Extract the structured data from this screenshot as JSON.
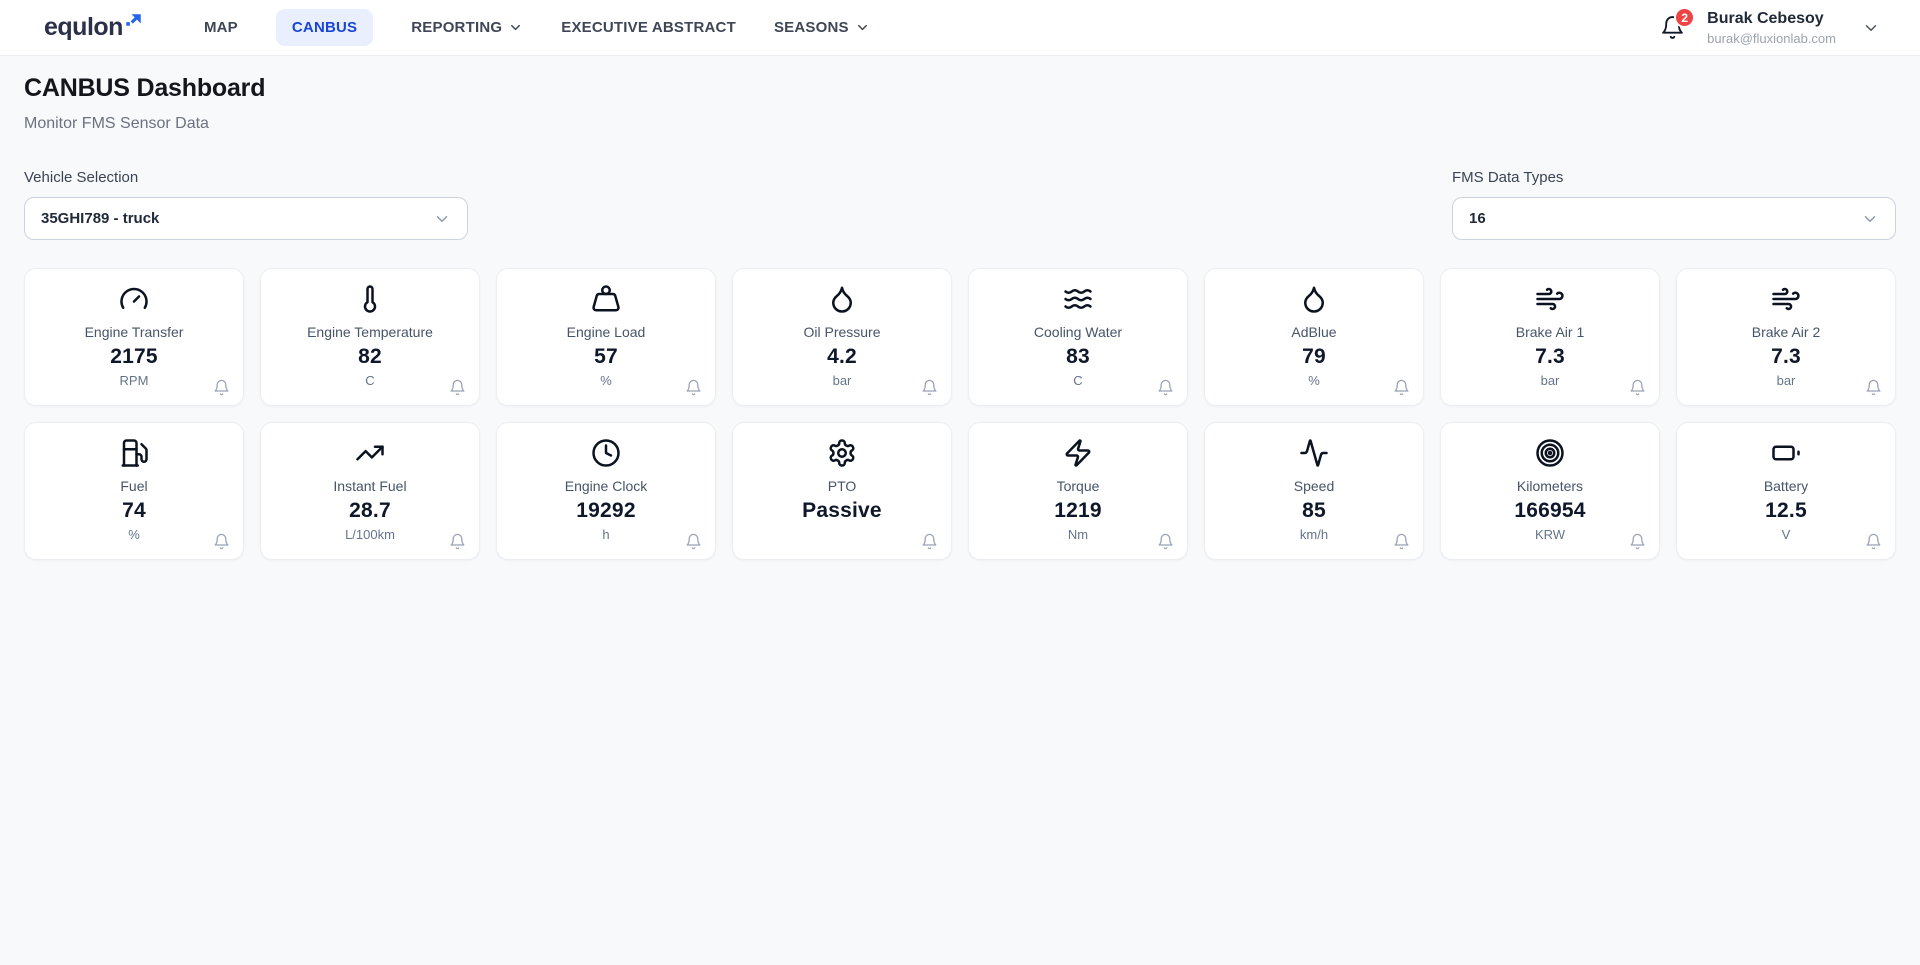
{
  "brand": {
    "logo_text": "equlon"
  },
  "nav": {
    "items": [
      {
        "label": "MAP",
        "active": false,
        "has_dropdown": false
      },
      {
        "label": "CANBUS",
        "active": true,
        "has_dropdown": false
      },
      {
        "label": "REPORTING",
        "active": false,
        "has_dropdown": true
      },
      {
        "label": "EXECUTIVE ABSTRACT",
        "active": false,
        "has_dropdown": false
      },
      {
        "label": "SEASONS",
        "active": false,
        "has_dropdown": true
      }
    ]
  },
  "user": {
    "name": "Burak Cebesoy",
    "email": "burak@fluxionlab.com",
    "notification_count": "2"
  },
  "page": {
    "title": "CANBUS Dashboard",
    "subtitle": "Monitor FMS Sensor Data"
  },
  "filters": {
    "vehicle": {
      "label": "Vehicle Selection",
      "selected": "35GHI789 - truck"
    },
    "fms": {
      "label": "FMS Data Types",
      "selected": "16"
    }
  },
  "colors": {
    "accent": "#1a46d8",
    "accent_bg": "#e9effc",
    "logo_arrow": "#2563eb",
    "badge": "#ef4444",
    "page_bg": "#f8f9fb"
  },
  "sensors": [
    {
      "label": "Engine Transfer",
      "value": "2175",
      "unit": "RPM",
      "icon": "gauge-icon"
    },
    {
      "label": "Engine Temperature",
      "value": "82",
      "unit": "C",
      "icon": "thermometer-icon"
    },
    {
      "label": "Engine Load",
      "value": "57",
      "unit": "%",
      "icon": "weight-icon"
    },
    {
      "label": "Oil Pressure",
      "value": "4.2",
      "unit": "bar",
      "icon": "droplet-icon"
    },
    {
      "label": "Cooling Water",
      "value": "83",
      "unit": "C",
      "icon": "waves-icon"
    },
    {
      "label": "AdBlue",
      "value": "79",
      "unit": "%",
      "icon": "droplet-icon"
    },
    {
      "label": "Brake Air 1",
      "value": "7.3",
      "unit": "bar",
      "icon": "wind-icon"
    },
    {
      "label": "Brake Air 2",
      "value": "7.3",
      "unit": "bar",
      "icon": "wind-icon"
    },
    {
      "label": "Fuel",
      "value": "74",
      "unit": "%",
      "icon": "fuel-pump-icon"
    },
    {
      "label": "Instant Fuel",
      "value": "28.7",
      "unit": "L/100km",
      "icon": "trending-up-icon"
    },
    {
      "label": "Engine Clock",
      "value": "19292",
      "unit": "h",
      "icon": "clock-icon"
    },
    {
      "label": "PTO",
      "value": "Passive",
      "unit": "",
      "icon": "gear-icon"
    },
    {
      "label": "Torque",
      "value": "1219",
      "unit": "Nm",
      "icon": "zap-icon"
    },
    {
      "label": "Speed",
      "value": "85",
      "unit": "km/h",
      "icon": "activity-icon"
    },
    {
      "label": "Kilometers",
      "value": "166954",
      "unit": "KRW",
      "icon": "target-icon"
    },
    {
      "label": "Battery",
      "value": "12.5",
      "unit": "V",
      "icon": "battery-icon"
    }
  ]
}
